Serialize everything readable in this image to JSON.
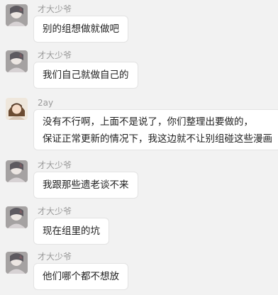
{
  "messages": [
    {
      "sender": "才大少爷",
      "avatar": "avatar-caidashaoye",
      "lines": [
        "别的组想做就做吧"
      ]
    },
    {
      "sender": "才大少爷",
      "avatar": "avatar-caidashaoye",
      "lines": [
        "我们自己就做自己的"
      ]
    },
    {
      "sender": "2ay",
      "avatar": "avatar-2ay",
      "lines": [
        "没有不行啊，上面不是说了，你们整理出要做的，",
        "保证正常更新的情况下，我这边就不让别组碰这些漫画"
      ]
    },
    {
      "sender": "才大少爷",
      "avatar": "avatar-caidashaoye",
      "lines": [
        "我跟那些遗老谈不来"
      ]
    },
    {
      "sender": "才大少爷",
      "avatar": "avatar-caidashaoye",
      "lines": [
        "现在组里的坑"
      ]
    },
    {
      "sender": "才大少爷",
      "avatar": "avatar-caidashaoye",
      "lines": [
        "他们哪个都不想放"
      ]
    }
  ]
}
